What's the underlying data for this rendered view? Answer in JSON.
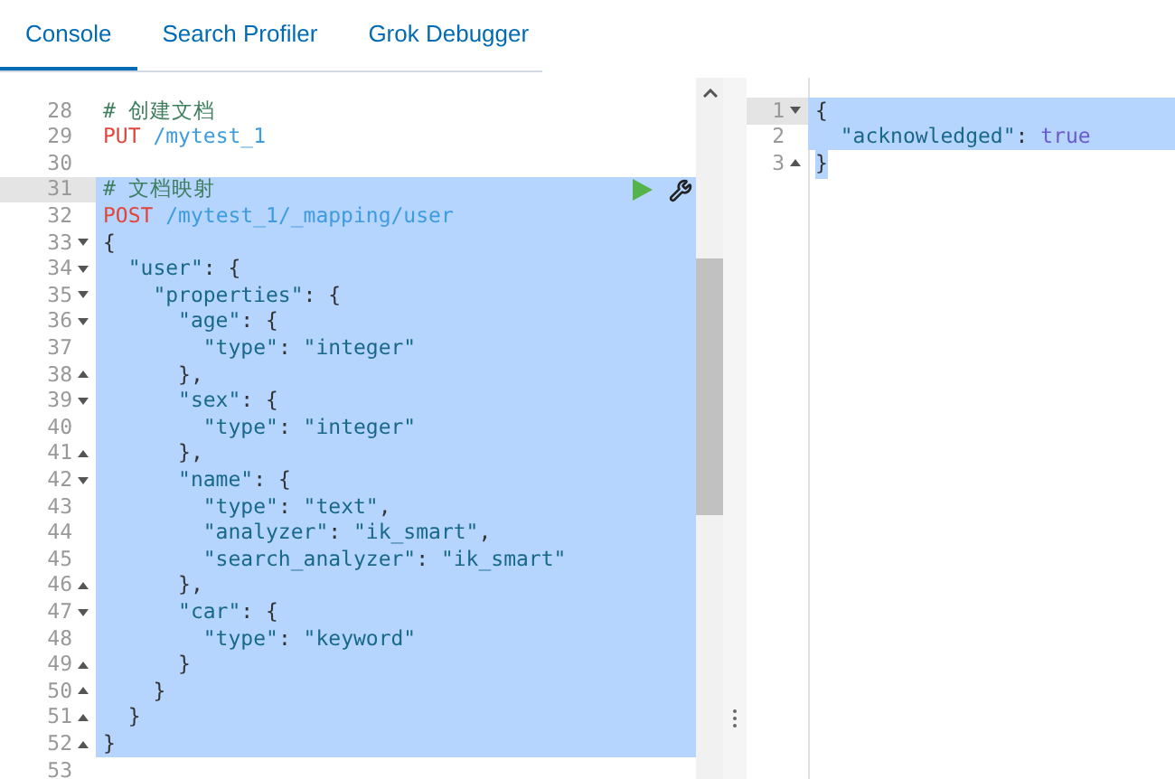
{
  "tabs": [
    {
      "label": "Console",
      "selected": true
    },
    {
      "label": "Search Profiler",
      "selected": false
    },
    {
      "label": "Grok Debugger",
      "selected": false
    }
  ],
  "request_editor": {
    "lines": [
      {
        "number": "28",
        "kind": "plain",
        "active": false,
        "selected": false,
        "tokens": [
          {
            "kind": "comment",
            "text": "# 创建文档"
          }
        ]
      },
      {
        "number": "29",
        "kind": "plain",
        "active": false,
        "selected": false,
        "tokens": [
          {
            "kind": "method",
            "text": "PUT"
          },
          {
            "kind": "url",
            "text": " /mytest_1"
          }
        ]
      },
      {
        "number": "30",
        "kind": "plain",
        "active": false,
        "selected": false
      },
      {
        "number": "31",
        "kind": "plain",
        "active": true,
        "selected": true,
        "tokens": [
          {
            "kind": "comment",
            "text": "# 文档映射"
          }
        ]
      },
      {
        "number": "32",
        "kind": "plain",
        "active": false,
        "selected": true,
        "tokens": [
          {
            "kind": "method",
            "text": "POST"
          },
          {
            "kind": "url",
            "text": " /mytest_1/_mapping/user"
          }
        ]
      },
      {
        "number": "33",
        "kind": "fold-open",
        "active": false,
        "selected": true,
        "tokens": [
          {
            "kind": "punct",
            "text": "{"
          }
        ]
      },
      {
        "number": "34",
        "kind": "fold-open",
        "active": false,
        "selected": true,
        "tokens": [
          {
            "kind": "string",
            "text": "  \"user\""
          },
          {
            "kind": "punct",
            "text": ": {"
          }
        ]
      },
      {
        "number": "35",
        "kind": "fold-open",
        "active": false,
        "selected": true,
        "tokens": [
          {
            "kind": "string",
            "text": "    \"properties\""
          },
          {
            "kind": "punct",
            "text": ": {"
          }
        ]
      },
      {
        "number": "36",
        "kind": "fold-open",
        "active": false,
        "selected": true,
        "tokens": [
          {
            "kind": "string",
            "text": "      \"age\""
          },
          {
            "kind": "punct",
            "text": ": {"
          }
        ]
      },
      {
        "number": "37",
        "kind": "plain",
        "active": false,
        "selected": true,
        "tokens": [
          {
            "kind": "string",
            "text": "        \"type\""
          },
          {
            "kind": "punct",
            "text": ": "
          },
          {
            "kind": "string",
            "text": "\"integer\""
          }
        ]
      },
      {
        "number": "38",
        "kind": "fold-close",
        "active": false,
        "selected": true,
        "tokens": [
          {
            "kind": "punct",
            "text": "      },"
          }
        ]
      },
      {
        "number": "39",
        "kind": "fold-open",
        "active": false,
        "selected": true,
        "tokens": [
          {
            "kind": "string",
            "text": "      \"sex\""
          },
          {
            "kind": "punct",
            "text": ": {"
          }
        ]
      },
      {
        "number": "40",
        "kind": "plain",
        "active": false,
        "selected": true,
        "tokens": [
          {
            "kind": "string",
            "text": "        \"type\""
          },
          {
            "kind": "punct",
            "text": ": "
          },
          {
            "kind": "string",
            "text": "\"integer\""
          }
        ]
      },
      {
        "number": "41",
        "kind": "fold-close",
        "active": false,
        "selected": true,
        "tokens": [
          {
            "kind": "punct",
            "text": "      },"
          }
        ]
      },
      {
        "number": "42",
        "kind": "fold-open",
        "active": false,
        "selected": true,
        "tokens": [
          {
            "kind": "string",
            "text": "      \"name\""
          },
          {
            "kind": "punct",
            "text": ": {"
          }
        ]
      },
      {
        "number": "43",
        "kind": "plain",
        "active": false,
        "selected": true,
        "tokens": [
          {
            "kind": "string",
            "text": "        \"type\""
          },
          {
            "kind": "punct",
            "text": ": "
          },
          {
            "kind": "string",
            "text": "\"text\""
          },
          {
            "kind": "punct",
            "text": ","
          }
        ]
      },
      {
        "number": "44",
        "kind": "plain",
        "active": false,
        "selected": true,
        "tokens": [
          {
            "kind": "string",
            "text": "        \"analyzer\""
          },
          {
            "kind": "punct",
            "text": ": "
          },
          {
            "kind": "string",
            "text": "\"ik_smart\""
          },
          {
            "kind": "punct",
            "text": ","
          }
        ]
      },
      {
        "number": "45",
        "kind": "plain",
        "active": false,
        "selected": true,
        "tokens": [
          {
            "kind": "string",
            "text": "        \"search_analyzer\""
          },
          {
            "kind": "punct",
            "text": ": "
          },
          {
            "kind": "string",
            "text": "\"ik_smart\""
          }
        ]
      },
      {
        "number": "46",
        "kind": "fold-close",
        "active": false,
        "selected": true,
        "tokens": [
          {
            "kind": "punct",
            "text": "      },"
          }
        ]
      },
      {
        "number": "47",
        "kind": "fold-open",
        "active": false,
        "selected": true,
        "tokens": [
          {
            "kind": "string",
            "text": "      \"car\""
          },
          {
            "kind": "punct",
            "text": ": {"
          }
        ]
      },
      {
        "number": "48",
        "kind": "plain",
        "active": false,
        "selected": true,
        "tokens": [
          {
            "kind": "string",
            "text": "        \"type\""
          },
          {
            "kind": "punct",
            "text": ": "
          },
          {
            "kind": "string",
            "text": "\"keyword\""
          }
        ]
      },
      {
        "number": "49",
        "kind": "fold-close",
        "active": false,
        "selected": true,
        "tokens": [
          {
            "kind": "punct",
            "text": "      }"
          }
        ]
      },
      {
        "number": "50",
        "kind": "fold-close",
        "active": false,
        "selected": true,
        "tokens": [
          {
            "kind": "punct",
            "text": "    }"
          }
        ]
      },
      {
        "number": "51",
        "kind": "fold-close",
        "active": false,
        "selected": true,
        "tokens": [
          {
            "kind": "punct",
            "text": "  }"
          }
        ]
      },
      {
        "number": "52",
        "kind": "fold-close",
        "active": false,
        "selected": true,
        "tokens": [
          {
            "kind": "punct",
            "text": "}"
          }
        ]
      },
      {
        "number": "53",
        "kind": "plain",
        "active": false,
        "selected": false
      }
    ]
  },
  "response_editor": {
    "lines": [
      {
        "number": "1",
        "kind": "fold-open",
        "active": true,
        "selected": true,
        "selection_ends_at_text": false,
        "tokens": [
          {
            "kind": "punct",
            "text": "{"
          }
        ]
      },
      {
        "number": "2",
        "kind": "plain",
        "active": false,
        "selected": true,
        "selection_ends_at_text": false,
        "tokens": [
          {
            "kind": "string",
            "text": "  \"acknowledged\""
          },
          {
            "kind": "punct",
            "text": ": "
          },
          {
            "kind": "bool",
            "text": "true"
          }
        ]
      },
      {
        "number": "3",
        "kind": "fold-close",
        "active": false,
        "selected": true,
        "selection_ends_at_text": true,
        "tokens": [
          {
            "kind": "punct",
            "text": "}"
          }
        ]
      }
    ]
  }
}
